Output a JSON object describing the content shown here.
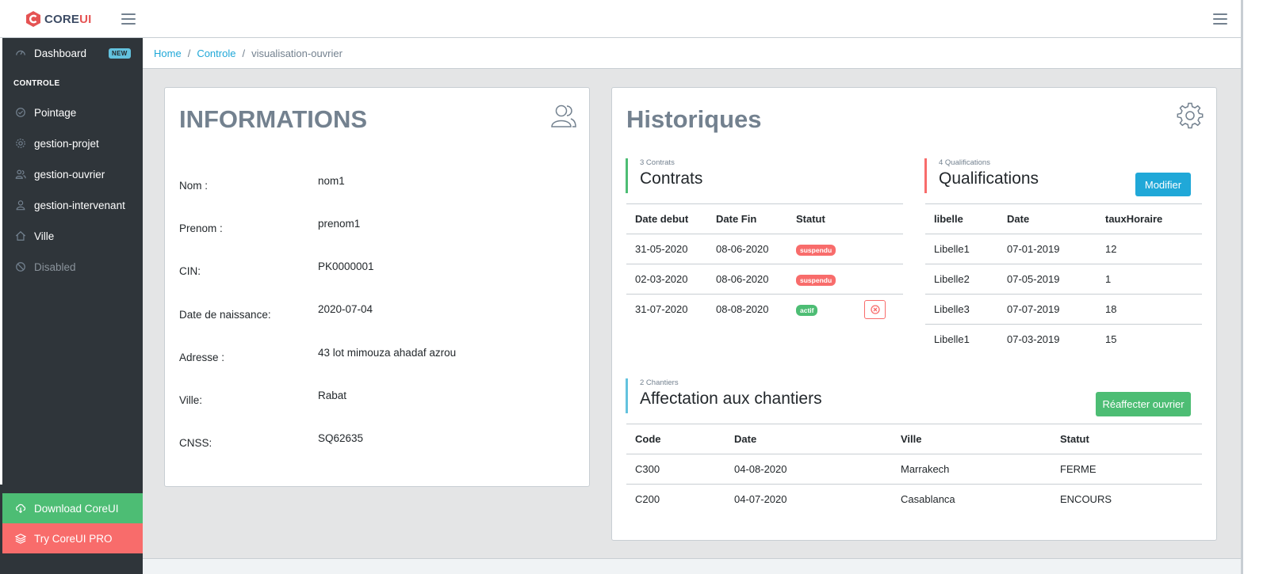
{
  "brand": {
    "name_main": "CORE",
    "name_accent": "UI"
  },
  "sidebar": {
    "items": [
      {
        "label": "Dashboard",
        "icon": "speedometer-icon",
        "badge": "NEW"
      },
      {
        "label": "Pointage",
        "icon": "check-icon"
      },
      {
        "label": "gestion-projet",
        "icon": "settings-icon"
      },
      {
        "label": "gestion-ouvrier",
        "icon": "people-icon"
      },
      {
        "label": "gestion-intervenant",
        "icon": "user-icon"
      },
      {
        "label": "Ville",
        "icon": "home-icon"
      },
      {
        "label": "Disabled",
        "icon": "ban-icon"
      }
    ],
    "section_title": "CONTROLE",
    "download": "Download CoreUI",
    "pro": "Try CoreUI PRO"
  },
  "breadcrumb": {
    "home": "Home",
    "controle": "Controle",
    "current": "visualisation-ouvrier"
  },
  "info": {
    "title": "INFORMATIONS",
    "fields": [
      {
        "label": "Nom :",
        "value": "nom1"
      },
      {
        "label": "Prenom :",
        "value": "prenom1"
      },
      {
        "label": "CIN:",
        "value": "PK0000001"
      },
      {
        "label": "Date de naissance:",
        "value": "2020-07-04"
      },
      {
        "label": "Adresse :",
        "value": "43 lot mimouza ahadaf azrou"
      },
      {
        "label": "Ville:",
        "value": "Rabat"
      },
      {
        "label": "CNSS:",
        "value": "SQ62635"
      }
    ]
  },
  "historiques": {
    "title": "Historiques",
    "contrats": {
      "count_label": "3 Contrats",
      "title": "Contrats",
      "headers": [
        "Date debut",
        "Date Fin",
        "Statut"
      ],
      "rows": [
        {
          "debut": "31-05-2020",
          "fin": "08-06-2020",
          "statut": "suspendu"
        },
        {
          "debut": "02-03-2020",
          "fin": "08-06-2020",
          "statut": "suspendu"
        },
        {
          "debut": "31-07-2020",
          "fin": "08-08-2020",
          "statut": "actif"
        }
      ]
    },
    "qualifications": {
      "count_label": "4 Qualifications",
      "title": "Qualifications",
      "button": "Modifier",
      "headers": [
        "libelle",
        "Date",
        "tauxHoraire"
      ],
      "rows": [
        {
          "libelle": "Libelle1",
          "date": "07-01-2019",
          "taux": "12"
        },
        {
          "libelle": "Libelle2",
          "date": "07-05-2019",
          "taux": "1"
        },
        {
          "libelle": "Libelle3",
          "date": "07-07-2019",
          "taux": "18"
        },
        {
          "libelle": "Libelle1",
          "date": "07-03-2019",
          "taux": "15"
        }
      ]
    },
    "chantiers": {
      "count_label": "2 Chantiers",
      "title": "Affectation aux chantiers",
      "button": "Réaffecter ouvrier",
      "headers": [
        "Code",
        "Date",
        "Ville",
        "Statut"
      ],
      "rows": [
        {
          "code": "C300",
          "date": "04-08-2020",
          "ville": "Marrakech",
          "statut": "FERME"
        },
        {
          "code": "C200",
          "date": "04-07-2020",
          "ville": "Casablanca",
          "statut": "ENCOURS"
        }
      ]
    }
  },
  "colors": {
    "primary": "#20a8d8",
    "success": "#4dbd74",
    "danger": "#f86c6b",
    "sidebar": "#2f353a",
    "info": "#63c2de"
  }
}
